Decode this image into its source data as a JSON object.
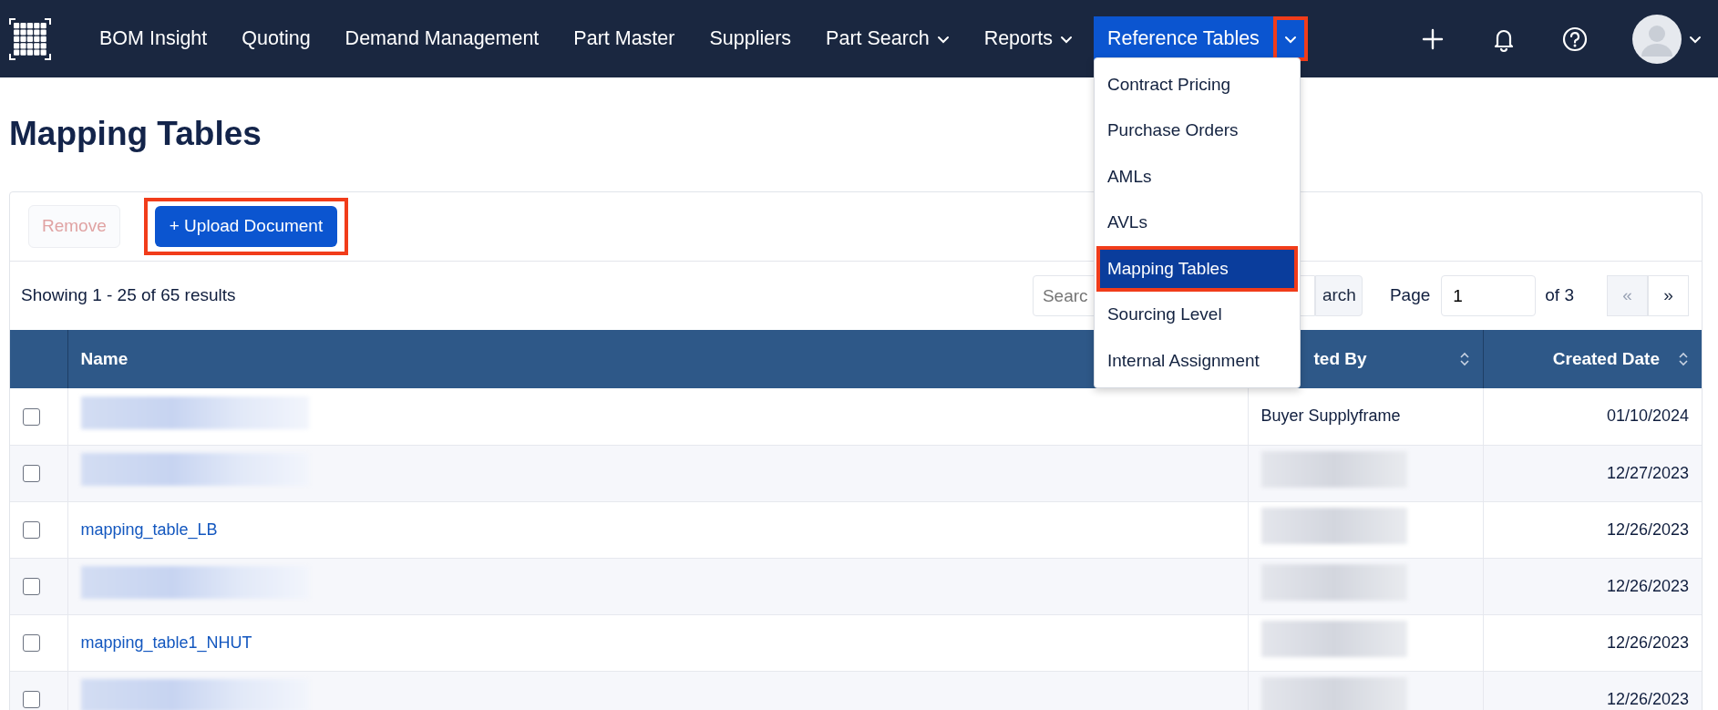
{
  "navbar": {
    "items": [
      {
        "label": "BOM Insight",
        "dropdown": false,
        "active": false,
        "highlighted": false
      },
      {
        "label": "Quoting",
        "dropdown": false,
        "active": false,
        "highlighted": false
      },
      {
        "label": "Demand Management",
        "dropdown": false,
        "active": false,
        "highlighted": false
      },
      {
        "label": "Part Master",
        "dropdown": false,
        "active": false,
        "highlighted": false
      },
      {
        "label": "Suppliers",
        "dropdown": false,
        "active": false,
        "highlighted": false
      },
      {
        "label": "Part Search",
        "dropdown": true,
        "active": false,
        "highlighted": false
      },
      {
        "label": "Reports",
        "dropdown": true,
        "active": false,
        "highlighted": false
      },
      {
        "label": "Reference Tables",
        "dropdown": true,
        "active": true,
        "highlighted": true
      }
    ],
    "menu": [
      {
        "label": "Contract Pricing",
        "selected": false,
        "highlighted": false
      },
      {
        "label": "Purchase Orders",
        "selected": false,
        "highlighted": false
      },
      {
        "label": "AMLs",
        "selected": false,
        "highlighted": false
      },
      {
        "label": "AVLs",
        "selected": false,
        "highlighted": false
      },
      {
        "label": "Mapping Tables",
        "selected": true,
        "highlighted": true
      },
      {
        "label": "Sourcing Level",
        "selected": false,
        "highlighted": false
      },
      {
        "label": "Internal Assignment",
        "selected": false,
        "highlighted": false
      }
    ]
  },
  "page_title": "Mapping Tables",
  "toolbar": {
    "buttons": [
      {
        "label": "Remove",
        "kind": "secondary",
        "disabled": true,
        "highlighted": false
      },
      {
        "label": "+ Upload Document",
        "kind": "primary",
        "disabled": false,
        "highlighted": true
      }
    ]
  },
  "results_summary": "Showing 1 - 25 of 65 results",
  "search": {
    "placeholder": "Searc",
    "button": "arch"
  },
  "pagination": {
    "label": "Page",
    "value": "1",
    "total": "of 3",
    "prev": "«",
    "next": "»",
    "prev_disabled": true
  },
  "table": {
    "columns": [
      {
        "label": "Name",
        "sortable": false
      },
      {
        "label": "ted By",
        "sortable": true
      },
      {
        "label": "Created Date",
        "sortable": true
      }
    ],
    "rows": [
      {
        "checked": false,
        "name": {
          "kind": "redacted"
        },
        "created_by": {
          "kind": "text",
          "text": "Buyer Supplyframe"
        },
        "created_date": "01/10/2024"
      },
      {
        "checked": false,
        "name": {
          "kind": "redacted"
        },
        "created_by": {
          "kind": "redacted"
        },
        "created_date": "12/27/2023"
      },
      {
        "checked": false,
        "name": {
          "kind": "link",
          "text": "mapping_table_LB"
        },
        "created_by": {
          "kind": "redacted"
        },
        "created_date": "12/26/2023"
      },
      {
        "checked": false,
        "name": {
          "kind": "redacted"
        },
        "created_by": {
          "kind": "redacted"
        },
        "created_date": "12/26/2023"
      },
      {
        "checked": false,
        "name": {
          "kind": "link",
          "text": "mapping_table1_NHUT"
        },
        "created_by": {
          "kind": "redacted"
        },
        "created_date": "12/26/2023"
      },
      {
        "checked": false,
        "name": {
          "kind": "redacted"
        },
        "created_by": {
          "kind": "redacted"
        },
        "created_date": "12/26/2023"
      }
    ]
  }
}
